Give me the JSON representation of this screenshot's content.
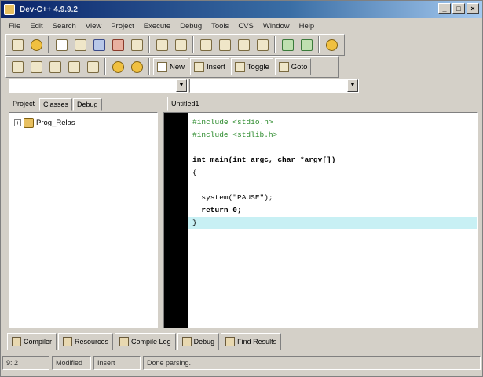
{
  "window": {
    "title": "Dev-C++ 4.9.9.2"
  },
  "title_controls": {
    "minimize": "_",
    "maximize": "□",
    "close": "×"
  },
  "menu": [
    "File",
    "Edit",
    "Search",
    "View",
    "Project",
    "Execute",
    "Debug",
    "Tools",
    "CVS",
    "Window",
    "Help"
  ],
  "toolbar2": {
    "new_label": "New",
    "insert_label": "Insert",
    "toggle_label": "Toggle",
    "goto_label": "Goto"
  },
  "left_tabs": [
    "Project",
    "Classes",
    "Debug"
  ],
  "project_tree": {
    "expander": "+",
    "root": "Prog_Relas"
  },
  "editor_tabs": [
    "Untitled1"
  ],
  "code_lines": [
    [
      "#include <stdio.h>"
    ],
    [
      "#include <stdlib.h>"
    ],
    [
      ""
    ],
    [
      "int main(int argc, char *argv[])"
    ],
    [
      "{"
    ],
    [
      ""
    ],
    [
      "  system(\"PAUSE\");"
    ],
    [
      "  return 0;"
    ],
    [
      "}"
    ]
  ],
  "bottom_tabs": [
    "Compiler",
    "Resources",
    "Compile Log",
    "Debug",
    "Find Results"
  ],
  "status": {
    "position": "9: 2",
    "modified": "Modified",
    "mode": "Insert",
    "info": "Done parsing."
  }
}
